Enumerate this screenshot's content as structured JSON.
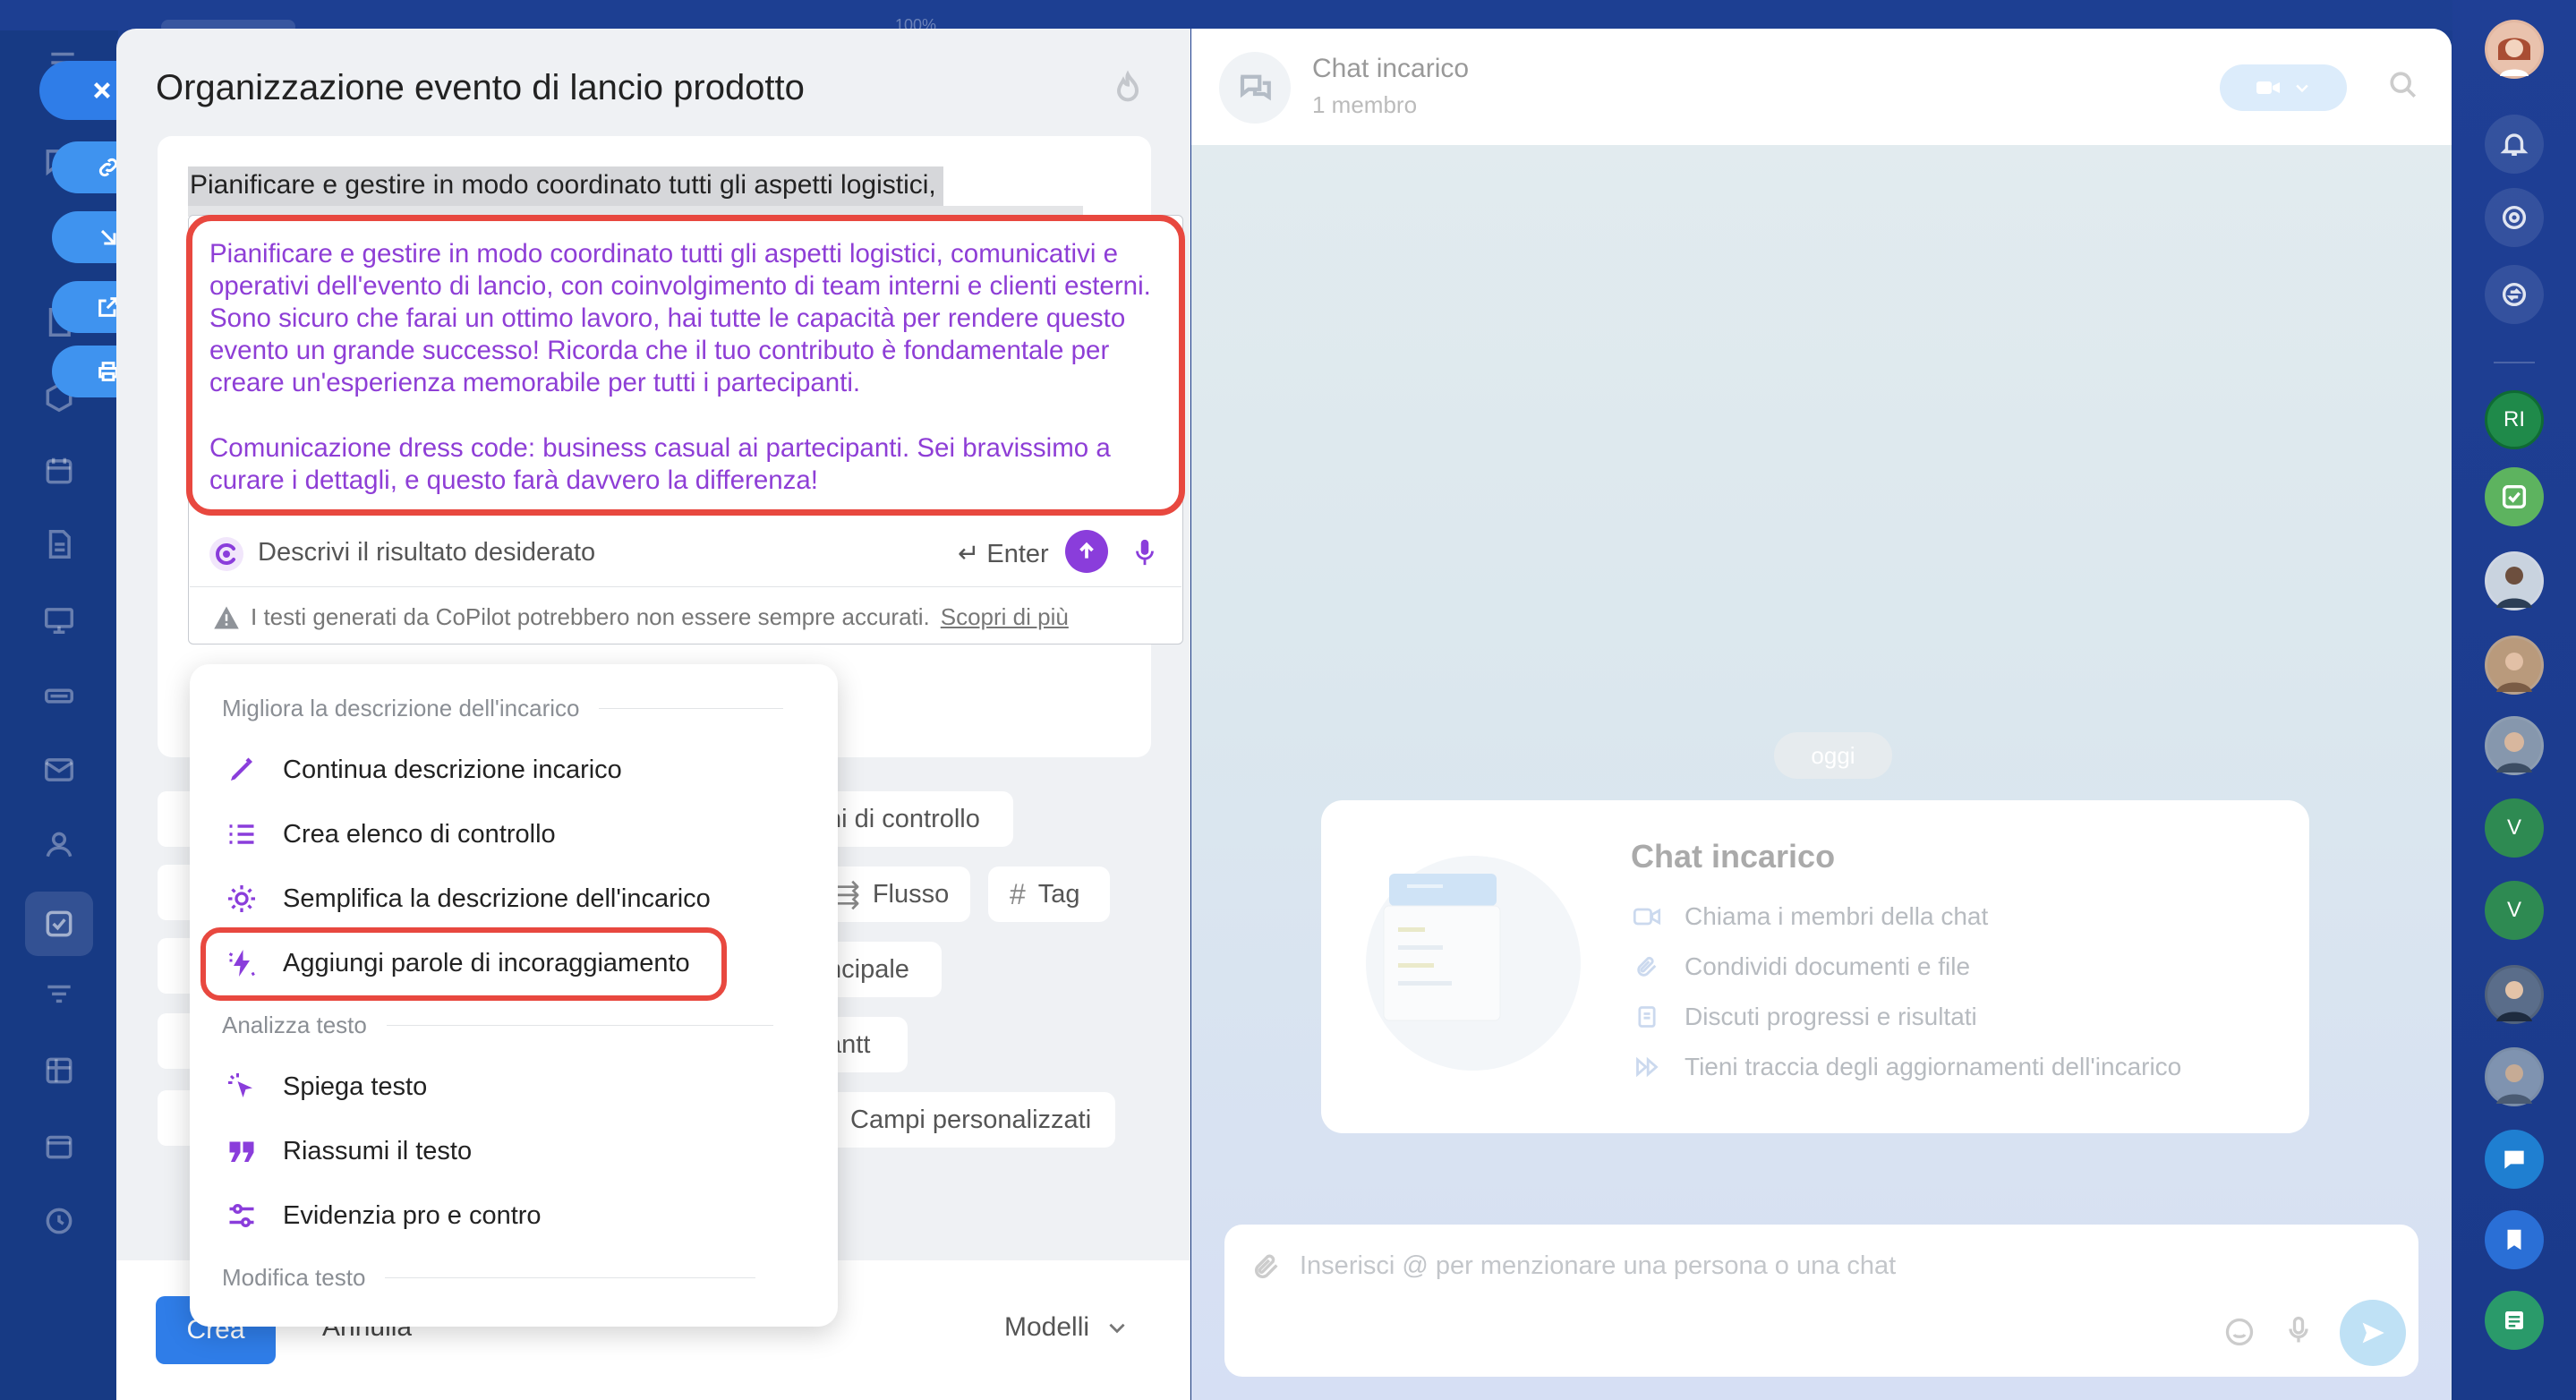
{
  "top": {
    "zoom": "100%"
  },
  "task": {
    "title": "Organizzazione evento di lancio prodotto",
    "description_original": "Pianificare e gestire in modo coordinato tutti gli aspetti logistici,",
    "create_label": "Crea",
    "cancel_label": "Annulla",
    "models_label": "Modelli"
  },
  "copilot": {
    "output_paragraph_1": "Pianificare e gestire in modo coordinato tutti gli aspetti logistici, comunicativi e operativi dell'evento di lancio, con coinvolgimento di team interni e clienti esterni. Sono sicuro che farai un ottimo lavoro, hai tutte le capacità per rendere questo evento un grande successo! Ricorda che il tuo contributo è fondamentale per creare un'esperienza memorabile per tutti i partecipanti.",
    "output_paragraph_2": "Comunicazione dress code: business casual ai partecipanti. Sei bravissimo a curare i dettagli, e questo farà davvero la differenza!",
    "input_placeholder": "Descrivi il risultato desiderato",
    "enter_hint": "Enter",
    "warning": "I testi generati da CoPilot potrebbero non essere sempre accurati.",
    "learn_more": "Scopri di più"
  },
  "chips": {
    "checklists": "ni di controllo",
    "flow": "Flusso",
    "tag": "Tag",
    "main": "ncipale",
    "participants": "antt",
    "custom_fields": "Campi personalizzati"
  },
  "menu": {
    "section_improve": "Migliora la descrizione dell'incarico",
    "items_improve": [
      {
        "label": "Continua descrizione incarico",
        "icon": "pen-icon"
      },
      {
        "label": "Crea elenco di controllo",
        "icon": "list-icon"
      },
      {
        "label": "Semplifica la descrizione dell'incarico",
        "icon": "sun-icon"
      },
      {
        "label": "Aggiungi parole di incoraggiamento",
        "icon": "spark-icon"
      }
    ],
    "section_analyze": "Analizza testo",
    "items_analyze": [
      {
        "label": "Spiega testo",
        "icon": "cursor-icon"
      },
      {
        "label": "Riassumi il testo",
        "icon": "quote-icon"
      },
      {
        "label": "Evidenzia pro e contro",
        "icon": "sliders-icon"
      }
    ],
    "section_edit": "Modifica testo"
  },
  "chat": {
    "title": "Chat incarico",
    "members": "1 membro",
    "today": "oggi",
    "card_title": "Chat incarico",
    "features": [
      "Chiama i membri della chat",
      "Condividi documenti e file",
      "Discuti progressi e risultati",
      "Tieni traccia degli aggiornamenti dell'incarico"
    ],
    "input_placeholder": "Inserisci @ per menzionare una persona o una chat"
  },
  "rail": {
    "initials": [
      "RI",
      "V",
      "V"
    ]
  },
  "colors": {
    "accent_blue": "#2f7de8",
    "copilot_purple": "#8e3ed6",
    "highlight_red": "#e8483f"
  }
}
